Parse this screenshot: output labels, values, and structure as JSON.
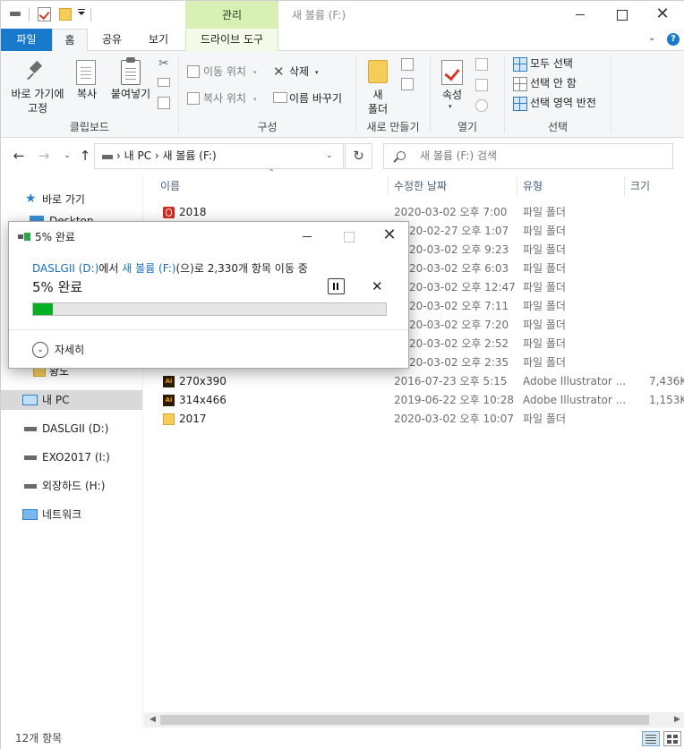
{
  "window": {
    "title": "새 볼륨 (F:)",
    "context_tab_header": "관리",
    "close_glyph": "✕"
  },
  "ribbon_tabs": {
    "file": "파일",
    "home": "홈",
    "share": "공유",
    "view": "보기",
    "drive_tools": "드라이브 도구",
    "collapse_glyph": "⌄",
    "help_glyph": "?"
  },
  "ribbon": {
    "clipboard": {
      "pin": "바로 가기에\n고정",
      "copy": "복사",
      "paste": "붙여넣기",
      "label": "클립보드"
    },
    "organize": {
      "move_to": "이동 위치",
      "copy_to": "복사 위치",
      "delete": "삭제",
      "rename": "이름 바꾸기",
      "label": "구성"
    },
    "new": {
      "new_folder": "새\n폴더",
      "label": "새로 만들기"
    },
    "open": {
      "properties": "속성",
      "label": "열기"
    },
    "select": {
      "select_all": "모두 선택",
      "select_none": "선택 안 함",
      "invert": "선택 영역 반전",
      "label": "선택"
    }
  },
  "nav": {
    "back": "←",
    "forward": "→",
    "history": "⌄",
    "up": "↑",
    "breadcrumb": "›  내 PC  ›  새 볼륨 (F:)",
    "refresh": "↻",
    "search_placeholder": "새 볼륨 (F:) 검색"
  },
  "nav_pane": {
    "quick_access": "바로 가기",
    "desktop": "Desktop",
    "folder_partial": "황노",
    "this_pc": "내 PC",
    "drives": [
      "DASLGII (D:)",
      "EXO2017 (I:)",
      "외장하드 (H:)"
    ],
    "network": "네트워크"
  },
  "file_list": {
    "columns": {
      "name": "이름",
      "modified": "수정한 날짜",
      "type": "유형",
      "size": "크기"
    },
    "rows": [
      {
        "name": "2018",
        "modified": "2020-03-02 오후 7:00",
        "type": "파일 폴더",
        "size": "",
        "icon": "opera-icon"
      },
      {
        "name": "",
        "modified": "20-02-27 오후 1:07",
        "type": "파일 폴더",
        "size": "",
        "icon": ""
      },
      {
        "name": "",
        "modified": "20-03-02 오후 9:23",
        "type": "파일 폴더",
        "size": "",
        "icon": ""
      },
      {
        "name": "",
        "modified": "20-03-02 오후 6:03",
        "type": "파일 폴더",
        "size": "",
        "icon": ""
      },
      {
        "name": "",
        "modified": "20-03-02 오후 12:47",
        "type": "파일 폴더",
        "size": "",
        "icon": ""
      },
      {
        "name": "",
        "modified": "20-03-02 오후 7:11",
        "type": "파일 폴더",
        "size": "",
        "icon": ""
      },
      {
        "name": "",
        "modified": "20-03-02 오후 7:20",
        "type": "파일 폴더",
        "size": "",
        "icon": ""
      },
      {
        "name": "",
        "modified": "20-03-02 오후 2:52",
        "type": "파일 폴더",
        "size": "",
        "icon": ""
      },
      {
        "name": "",
        "modified": "20-03-02 오후 2:35",
        "type": "파일 폴더",
        "size": "",
        "icon": ""
      },
      {
        "name": "270x390",
        "modified": "2016-07-23 오후 5:15",
        "type": "Adobe Illustrator ...",
        "size": "7,436K",
        "icon": "ai-icon"
      },
      {
        "name": "314x466",
        "modified": "2019-06-22 오후 10:28",
        "type": "Adobe Illustrator ...",
        "size": "1,153K",
        "icon": "ai-icon"
      },
      {
        "name": "2017",
        "modified": "2020-03-02 오후 10:07",
        "type": "파일 폴더",
        "size": "",
        "icon": "folder-icon"
      }
    ]
  },
  "status": {
    "item_count": "12개 항목"
  },
  "progress_dialog": {
    "title": "5% 완료",
    "source_drive": "DASLGII (D:)",
    "from_text": "에서 ",
    "dest_drive": "새 볼륨 (F:)",
    "rest_text": "(으)로 2,330개 항목 이동 중",
    "percent_label": "5% 완료",
    "progress_fraction": 0.055,
    "cancel_glyph": "✕",
    "close_glyph": "✕",
    "details_label": "자세히",
    "chevron_glyph": "⌄",
    "fill_color": "#06b025"
  }
}
